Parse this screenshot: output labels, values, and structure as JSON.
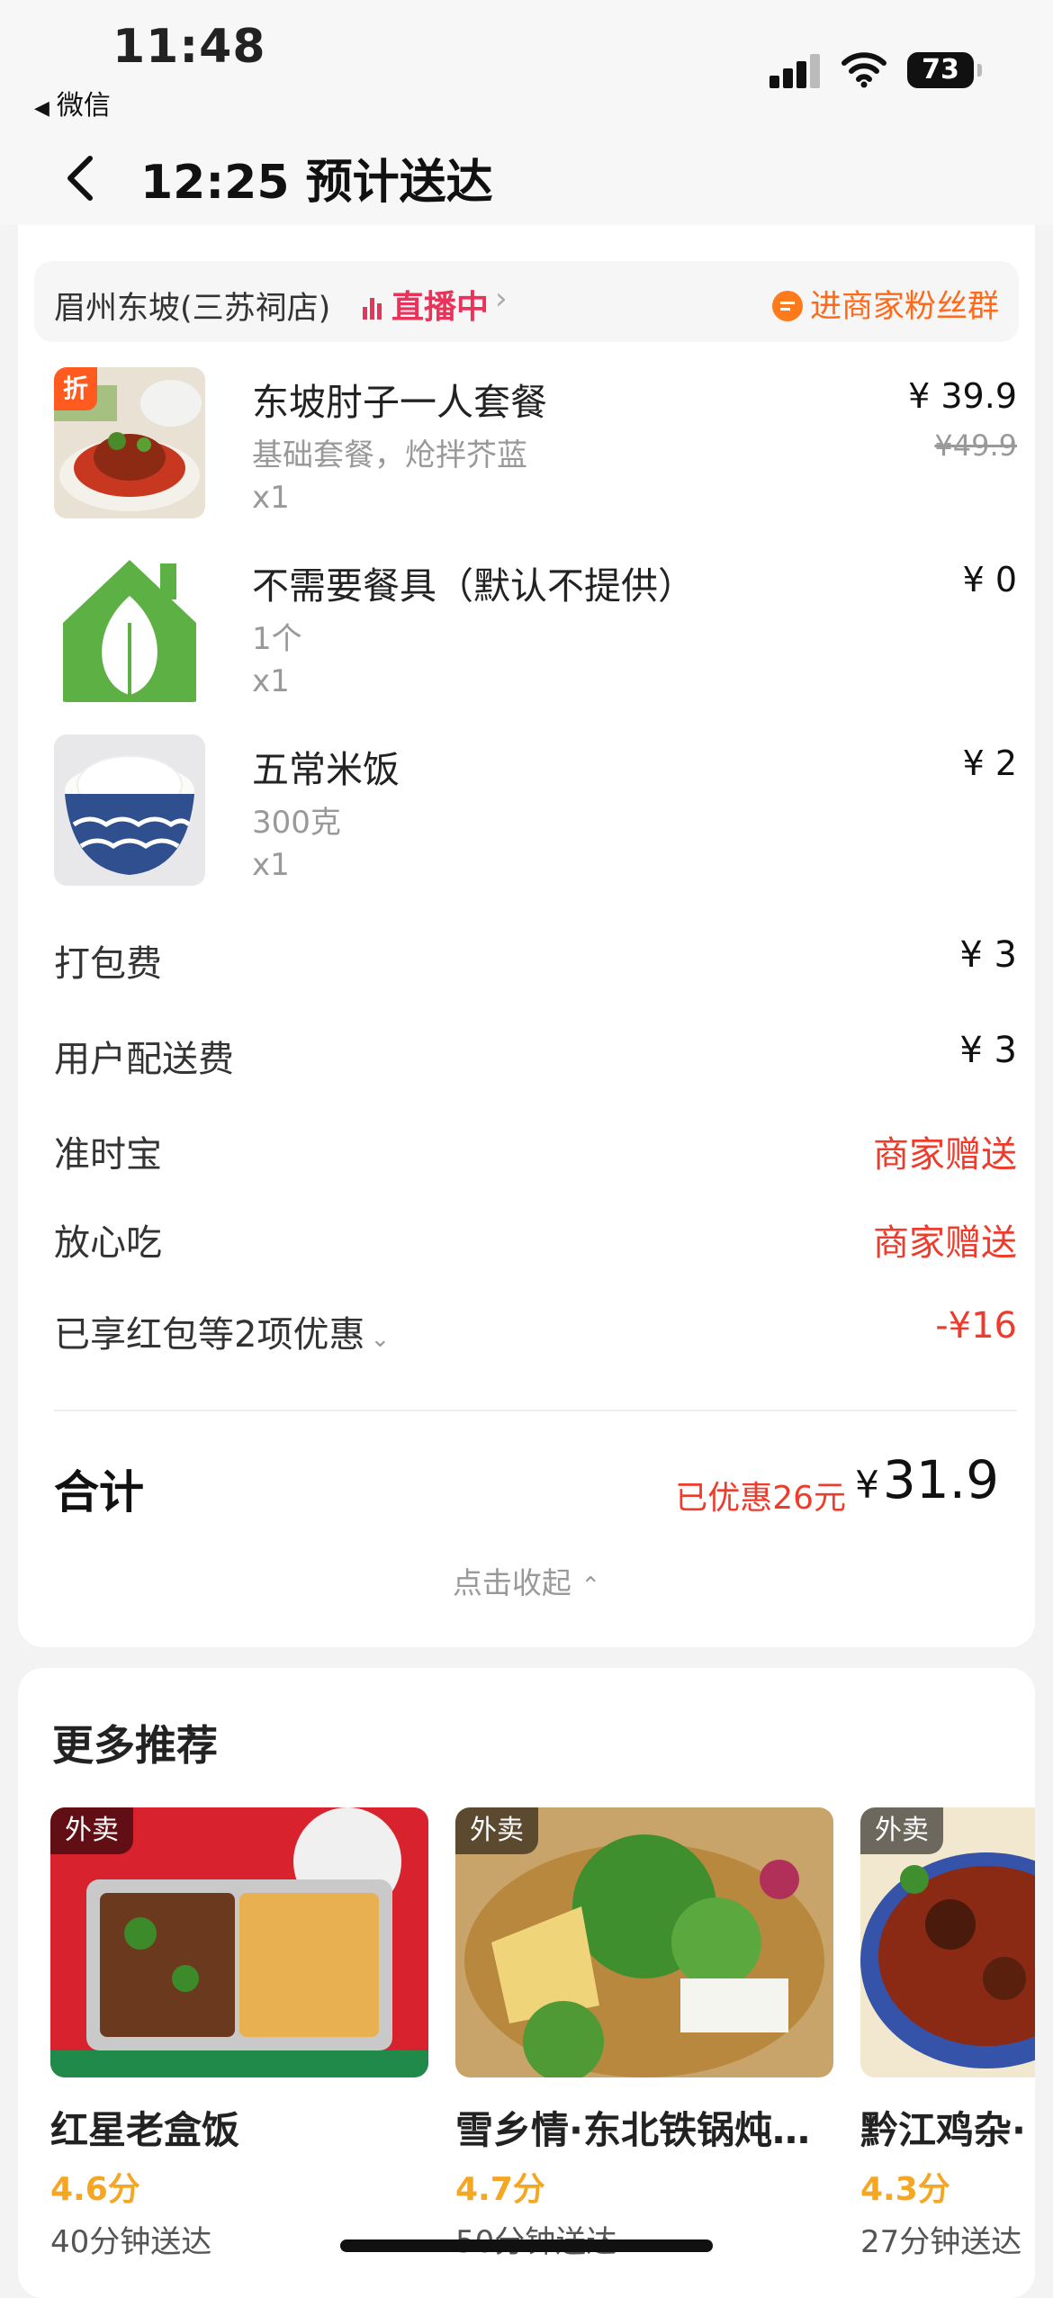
{
  "status_bar": {
    "time": "11:48",
    "back_app": "微信",
    "battery": "73"
  },
  "nav": {
    "title": "12:25 预计送达"
  },
  "shop": {
    "name": "眉州东坡(三苏祠店)",
    "live_label": "直播中",
    "fans_label": "进商家粉丝群"
  },
  "items": [
    {
      "name": "东坡肘子一人套餐",
      "sub": "基础套餐，炝拌芥蓝",
      "qty": "x1",
      "price": "¥ 39.9",
      "orig": "¥49.9",
      "tag": "折"
    },
    {
      "name": "不需要餐具（默认不提供）",
      "sub": "1个",
      "qty": "x1",
      "price": "¥ 0"
    },
    {
      "name": "五常米饭",
      "sub": "300克",
      "qty": "x1",
      "price": "¥ 2"
    }
  ],
  "fees": [
    {
      "label": "打包费",
      "value": "¥ 3"
    },
    {
      "label": "用户配送费",
      "value": "¥ 3"
    },
    {
      "label": "准时宝",
      "value": "商家赠送"
    },
    {
      "label": "放心吃",
      "value": "商家赠送"
    },
    {
      "label": "已享红包等2项优惠",
      "value": "-¥16"
    }
  ],
  "summary": {
    "total_label": "合计",
    "saved": "已优惠26元",
    "currency": "¥",
    "total": "31.9",
    "collapse": "点击收起"
  },
  "recommend": {
    "title": "更多推荐",
    "items": [
      {
        "tag": "外卖",
        "name": "红星老盒饭",
        "score": "4.6分",
        "time": "40分钟送达"
      },
      {
        "tag": "外卖",
        "name": "雪乡情·东北铁锅炖…",
        "score": "4.7分",
        "time": "50分钟送达"
      },
      {
        "tag": "外卖",
        "name": "黔江鸡杂·",
        "score": "4.3分",
        "time": "27分钟送达"
      }
    ]
  },
  "colors": {
    "accent_red": "#ee3b2c",
    "live_pink": "#e8335b",
    "orange": "#ff6a1a",
    "score_yellow": "#f5a623"
  }
}
